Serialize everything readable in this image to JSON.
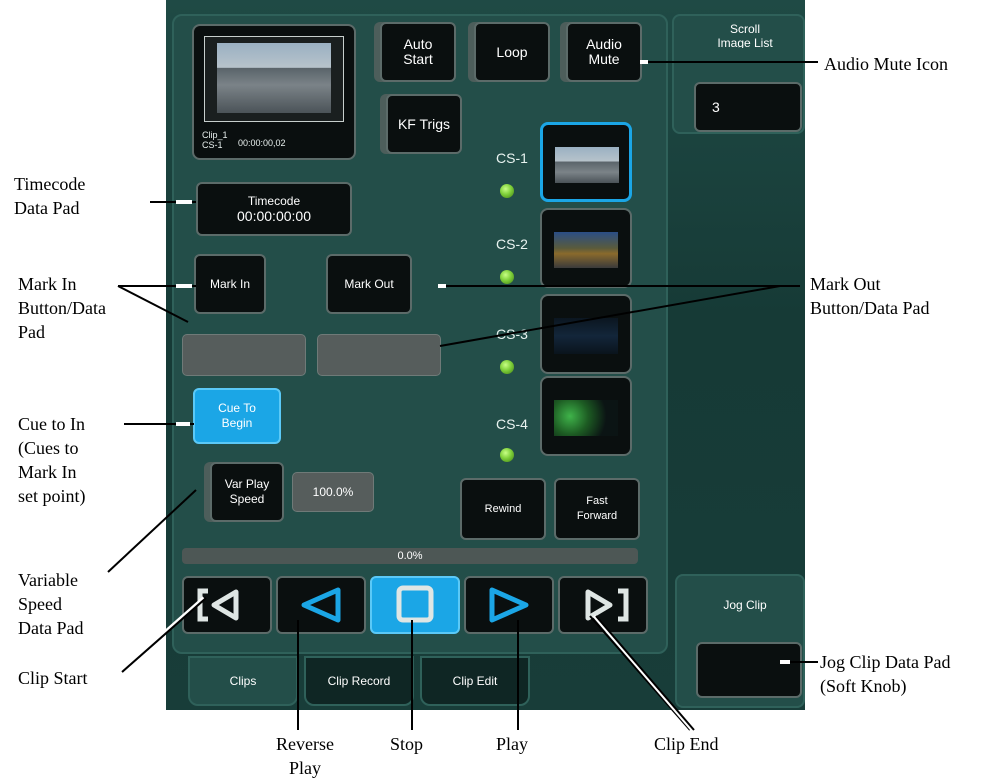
{
  "preview": {
    "clip_name": "Clip_1",
    "cs": "CS-1",
    "timecode": "00:00:00,02"
  },
  "top_buttons": {
    "auto_start": "Auto\nStart",
    "loop": "Loop",
    "audio_mute": "Audio\nMute",
    "kf_trigs": "KF Trigs"
  },
  "scroll": {
    "title": "Scroll\nImage List",
    "value": "3"
  },
  "timecode": {
    "label": "Timecode",
    "value": "00:00:00:00"
  },
  "mark": {
    "in_label": "Mark In",
    "out_label": "Mark Out",
    "in_value": "",
    "out_value": ""
  },
  "cue": {
    "label": "Cue To\nBegin"
  },
  "var_play": {
    "label": "Var Play\nSpeed",
    "value": "100.0%"
  },
  "channels": [
    {
      "label": "CS-1",
      "selected": true,
      "led": "green"
    },
    {
      "label": "CS-2",
      "selected": false,
      "led": "green"
    },
    {
      "label": "CS-3",
      "selected": false,
      "led": "green"
    },
    {
      "label": "CS-4",
      "selected": false,
      "led": "green"
    }
  ],
  "rewind_label": "Rewind",
  "fast_forward_label": "Fast\nForward",
  "progress": {
    "text": "0.0%",
    "value": 0
  },
  "transport_icons": [
    "clip-start-icon",
    "reverse-play-icon",
    "stop-icon",
    "play-icon",
    "clip-end-icon"
  ],
  "jog": {
    "label": "Jog Clip",
    "value": ""
  },
  "tabs": [
    {
      "label": "Clips",
      "active": true
    },
    {
      "label": "Clip Record",
      "active": false
    },
    {
      "label": "Clip Edit",
      "active": false
    }
  ],
  "annotations": {
    "audio_mute_icon": "Audio Mute Icon",
    "timecode_data_pad": "Timecode\nData Pad",
    "mark_in": "Mark In\nButton/Data\nPad",
    "mark_out": "Mark Out\nButton/Data Pad",
    "cue_to_in": "Cue to In\n(Cues to\nMark In\nset point)",
    "variable_speed": "Variable\nSpeed\nData Pad",
    "clip_start": "Clip Start",
    "jog_clip_pad": "Jog Clip Data Pad\n(Soft Knob)",
    "reverse_play": "Reverse\nPlay",
    "stop": "Stop",
    "play": "Play",
    "clip_end": "Clip End"
  },
  "colors": {
    "panel": "#1f4a45",
    "button": "#0a0f0f",
    "accent_cyan": "#1ba6e6",
    "led_green": "#7fd03a",
    "data_pad": "#565d5c"
  }
}
